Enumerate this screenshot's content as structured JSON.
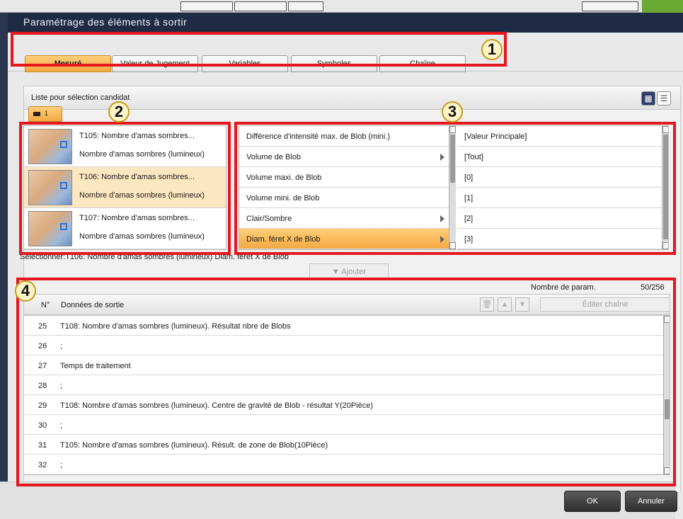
{
  "window_title": "Paramétrage des éléments à sortir",
  "tabs": [
    {
      "label": "Mesuré",
      "active": true
    },
    {
      "label": "Valeur de Jugement",
      "active": false
    },
    {
      "label": "Variables",
      "active": false
    },
    {
      "label": "Symboles",
      "active": false
    },
    {
      "label": "Chaîne",
      "active": false
    }
  ],
  "candidate_panel": {
    "title": "Liste pour sélection candidat",
    "view_grid_icon": "grid-view-icon",
    "view_list_icon": "list-view-icon",
    "camera_tab_label": "1",
    "items": [
      {
        "title": "T105: Nombre d'amas sombres...",
        "subtitle": "Nombre d'amas sombres (lumineux)",
        "selected": false
      },
      {
        "title": "T106: Nombre d'amas sombres...",
        "subtitle": "Nombre d'amas sombres (lumineux)",
        "selected": true
      },
      {
        "title": "T107: Nombre d'amas sombres...",
        "subtitle": "Nombre d'amas sombres (lumineux)",
        "selected": false
      }
    ]
  },
  "params": [
    {
      "label": "Différence d'intensité max. de Blob (mini.)",
      "has_submenu": false,
      "selected": false
    },
    {
      "label": "Volume de Blob",
      "has_submenu": true,
      "selected": false
    },
    {
      "label": "Volume maxi. de Blob",
      "has_submenu": false,
      "selected": false
    },
    {
      "label": "Volume mini. de Blob",
      "has_submenu": false,
      "selected": false
    },
    {
      "label": "Clair/Sombre",
      "has_submenu": true,
      "selected": false
    },
    {
      "label": "Diam. féret X de Blob",
      "has_submenu": true,
      "selected": true
    }
  ],
  "values": [
    "[Valeur Principale]",
    "[Tout]",
    "[0]",
    "[1]",
    "[2]",
    "[3]"
  ],
  "selection_info": "Sélectionner:T106: Nombre d'amas sombres (lumineux) Diam. féret X de Blob",
  "add_button": "▼ Ajouter",
  "output": {
    "count_label": "Nombre de param.",
    "count_value": "50/256",
    "col_no": "N°",
    "col_data": "Données de sortie",
    "edit_button": "Éditer chaîne",
    "rows": [
      {
        "n": "25",
        "text": "T108: Nombre d'amas sombres (lumineux). Résultat nbre de Blobs"
      },
      {
        "n": "26",
        "text": ";"
      },
      {
        "n": "27",
        "text": "Temps de traitement"
      },
      {
        "n": "28",
        "text": ";"
      },
      {
        "n": "29",
        "text": "T108: Nombre d'amas sombres (lumineux). Centre de gravité de Blob - résultat Y(20Pièce)"
      },
      {
        "n": "30",
        "text": ";"
      },
      {
        "n": "31",
        "text": "T105: Nombre d'amas sombres (lumineux). Résult. de zone de Blob(10Pièce)"
      },
      {
        "n": "32",
        "text": ";"
      }
    ]
  },
  "footer": {
    "ok": "OK",
    "cancel": "Annuler"
  },
  "markers": [
    "1",
    "2",
    "3",
    "4"
  ],
  "colors": {
    "accent": "#f5a841",
    "highlight": "#e4161e",
    "titlebar": "#1f2b45"
  }
}
